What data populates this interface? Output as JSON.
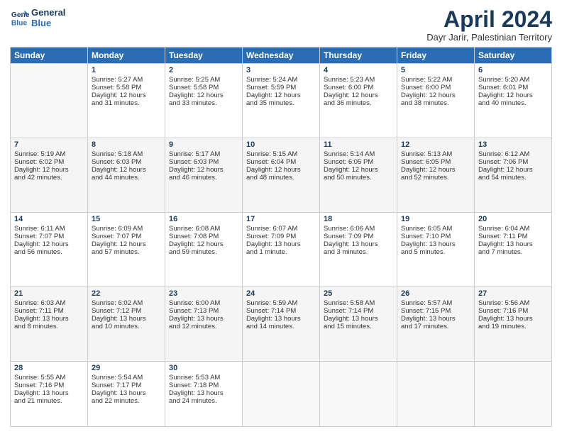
{
  "logo": {
    "line1": "General",
    "line2": "Blue"
  },
  "title": "April 2024",
  "subtitle": "Dayr Jarir, Palestinian Territory",
  "headers": [
    "Sunday",
    "Monday",
    "Tuesday",
    "Wednesday",
    "Thursday",
    "Friday",
    "Saturday"
  ],
  "weeks": [
    [
      {
        "day": "",
        "lines": []
      },
      {
        "day": "1",
        "lines": [
          "Sunrise: 5:27 AM",
          "Sunset: 5:58 PM",
          "Daylight: 12 hours",
          "and 31 minutes."
        ]
      },
      {
        "day": "2",
        "lines": [
          "Sunrise: 5:25 AM",
          "Sunset: 5:58 PM",
          "Daylight: 12 hours",
          "and 33 minutes."
        ]
      },
      {
        "day": "3",
        "lines": [
          "Sunrise: 5:24 AM",
          "Sunset: 5:59 PM",
          "Daylight: 12 hours",
          "and 35 minutes."
        ]
      },
      {
        "day": "4",
        "lines": [
          "Sunrise: 5:23 AM",
          "Sunset: 6:00 PM",
          "Daylight: 12 hours",
          "and 36 minutes."
        ]
      },
      {
        "day": "5",
        "lines": [
          "Sunrise: 5:22 AM",
          "Sunset: 6:00 PM",
          "Daylight: 12 hours",
          "and 38 minutes."
        ]
      },
      {
        "day": "6",
        "lines": [
          "Sunrise: 5:20 AM",
          "Sunset: 6:01 PM",
          "Daylight: 12 hours",
          "and 40 minutes."
        ]
      }
    ],
    [
      {
        "day": "7",
        "lines": [
          "Sunrise: 5:19 AM",
          "Sunset: 6:02 PM",
          "Daylight: 12 hours",
          "and 42 minutes."
        ]
      },
      {
        "day": "8",
        "lines": [
          "Sunrise: 5:18 AM",
          "Sunset: 6:03 PM",
          "Daylight: 12 hours",
          "and 44 minutes."
        ]
      },
      {
        "day": "9",
        "lines": [
          "Sunrise: 5:17 AM",
          "Sunset: 6:03 PM",
          "Daylight: 12 hours",
          "and 46 minutes."
        ]
      },
      {
        "day": "10",
        "lines": [
          "Sunrise: 5:15 AM",
          "Sunset: 6:04 PM",
          "Daylight: 12 hours",
          "and 48 minutes."
        ]
      },
      {
        "day": "11",
        "lines": [
          "Sunrise: 5:14 AM",
          "Sunset: 6:05 PM",
          "Daylight: 12 hours",
          "and 50 minutes."
        ]
      },
      {
        "day": "12",
        "lines": [
          "Sunrise: 5:13 AM",
          "Sunset: 6:05 PM",
          "Daylight: 12 hours",
          "and 52 minutes."
        ]
      },
      {
        "day": "13",
        "lines": [
          "Sunrise: 6:12 AM",
          "Sunset: 7:06 PM",
          "Daylight: 12 hours",
          "and 54 minutes."
        ]
      }
    ],
    [
      {
        "day": "14",
        "lines": [
          "Sunrise: 6:11 AM",
          "Sunset: 7:07 PM",
          "Daylight: 12 hours",
          "and 56 minutes."
        ]
      },
      {
        "day": "15",
        "lines": [
          "Sunrise: 6:09 AM",
          "Sunset: 7:07 PM",
          "Daylight: 12 hours",
          "and 57 minutes."
        ]
      },
      {
        "day": "16",
        "lines": [
          "Sunrise: 6:08 AM",
          "Sunset: 7:08 PM",
          "Daylight: 12 hours",
          "and 59 minutes."
        ]
      },
      {
        "day": "17",
        "lines": [
          "Sunrise: 6:07 AM",
          "Sunset: 7:09 PM",
          "Daylight: 13 hours",
          "and 1 minute."
        ]
      },
      {
        "day": "18",
        "lines": [
          "Sunrise: 6:06 AM",
          "Sunset: 7:09 PM",
          "Daylight: 13 hours",
          "and 3 minutes."
        ]
      },
      {
        "day": "19",
        "lines": [
          "Sunrise: 6:05 AM",
          "Sunset: 7:10 PM",
          "Daylight: 13 hours",
          "and 5 minutes."
        ]
      },
      {
        "day": "20",
        "lines": [
          "Sunrise: 6:04 AM",
          "Sunset: 7:11 PM",
          "Daylight: 13 hours",
          "and 7 minutes."
        ]
      }
    ],
    [
      {
        "day": "21",
        "lines": [
          "Sunrise: 6:03 AM",
          "Sunset: 7:11 PM",
          "Daylight: 13 hours",
          "and 8 minutes."
        ]
      },
      {
        "day": "22",
        "lines": [
          "Sunrise: 6:02 AM",
          "Sunset: 7:12 PM",
          "Daylight: 13 hours",
          "and 10 minutes."
        ]
      },
      {
        "day": "23",
        "lines": [
          "Sunrise: 6:00 AM",
          "Sunset: 7:13 PM",
          "Daylight: 13 hours",
          "and 12 minutes."
        ]
      },
      {
        "day": "24",
        "lines": [
          "Sunrise: 5:59 AM",
          "Sunset: 7:14 PM",
          "Daylight: 13 hours",
          "and 14 minutes."
        ]
      },
      {
        "day": "25",
        "lines": [
          "Sunrise: 5:58 AM",
          "Sunset: 7:14 PM",
          "Daylight: 13 hours",
          "and 15 minutes."
        ]
      },
      {
        "day": "26",
        "lines": [
          "Sunrise: 5:57 AM",
          "Sunset: 7:15 PM",
          "Daylight: 13 hours",
          "and 17 minutes."
        ]
      },
      {
        "day": "27",
        "lines": [
          "Sunrise: 5:56 AM",
          "Sunset: 7:16 PM",
          "Daylight: 13 hours",
          "and 19 minutes."
        ]
      }
    ],
    [
      {
        "day": "28",
        "lines": [
          "Sunrise: 5:55 AM",
          "Sunset: 7:16 PM",
          "Daylight: 13 hours",
          "and 21 minutes."
        ]
      },
      {
        "day": "29",
        "lines": [
          "Sunrise: 5:54 AM",
          "Sunset: 7:17 PM",
          "Daylight: 13 hours",
          "and 22 minutes."
        ]
      },
      {
        "day": "30",
        "lines": [
          "Sunrise: 5:53 AM",
          "Sunset: 7:18 PM",
          "Daylight: 13 hours",
          "and 24 minutes."
        ]
      },
      {
        "day": "",
        "lines": []
      },
      {
        "day": "",
        "lines": []
      },
      {
        "day": "",
        "lines": []
      },
      {
        "day": "",
        "lines": []
      }
    ]
  ]
}
